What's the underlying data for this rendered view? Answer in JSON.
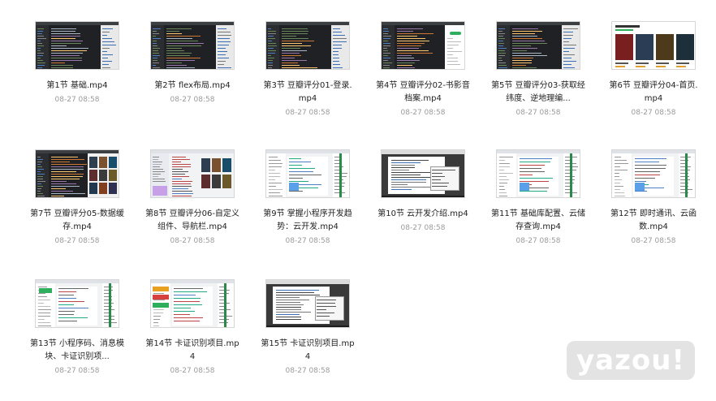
{
  "files": [
    {
      "name": "第1节 基础.mp4",
      "date": "08-27 08:58",
      "thumb": "dark-editor"
    },
    {
      "name": "第2节 flex布局.mp4",
      "date": "08-27 08:58",
      "thumb": "dark-editor"
    },
    {
      "name": "第3节 豆瓣评分01-登录.mp4",
      "date": "08-27 08:58",
      "thumb": "dark-editor"
    },
    {
      "name": "第4节 豆瓣评分02-书影音档案.mp4",
      "date": "08-27 08:58",
      "thumb": "dark-phone"
    },
    {
      "name": "第5节 豆瓣评分03-获取经纬度、逆地理编...",
      "date": "08-27 08:58",
      "thumb": "dark-editor"
    },
    {
      "name": "第6节 豆瓣评分04-首页.mp4",
      "date": "08-27 08:58",
      "thumb": "movie-posters"
    },
    {
      "name": "第7节 豆瓣评分05-数据缓存.mp4",
      "date": "08-27 08:58",
      "thumb": "dark-posters"
    },
    {
      "name": "第8节 豆瓣评分06-自定义组件、导航栏.mp4",
      "date": "08-27 08:58",
      "thumb": "light-posters"
    },
    {
      "name": "第9节 掌握小程序开发趋势：云开发.mp4",
      "date": "08-27 08:58",
      "thumb": "light-ide"
    },
    {
      "name": "第10节 云开发介绍.mp4",
      "date": "08-27 08:58",
      "thumb": "browser-doc"
    },
    {
      "name": "第11节 基础库配置、云储存查询.mp4",
      "date": "08-27 08:58",
      "thumb": "light-ide"
    },
    {
      "name": "第12节 即时通讯、云函数.mp4",
      "date": "08-27 08:58",
      "thumb": "light-ide"
    },
    {
      "name": "第13节 小程序码、消息模块、卡证识别项...",
      "date": "08-27 08:58",
      "thumb": "light-ide-green"
    },
    {
      "name": "第14节 卡证识别项目.mp4",
      "date": "08-27 08:58",
      "thumb": "light-ide-orange"
    },
    {
      "name": "第15节 卡证识别项目.mp4",
      "date": "08-27 08:58",
      "thumb": "browser-doc"
    }
  ],
  "watermark": "yazou!"
}
